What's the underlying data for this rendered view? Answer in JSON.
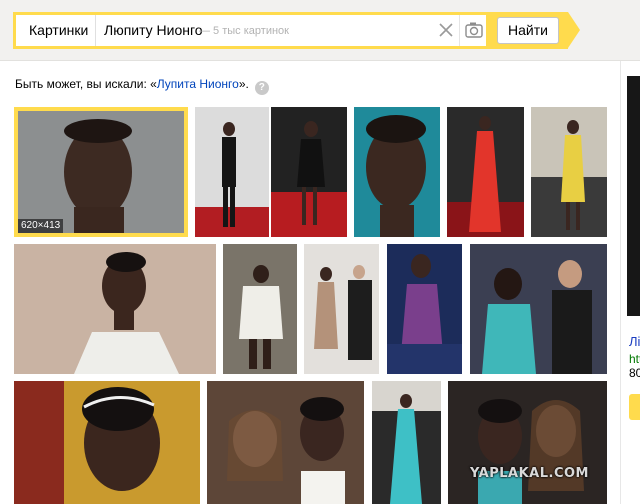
{
  "search": {
    "scope": "Картинки",
    "query": "Люпиту Нионго",
    "hint": "— 5 тыс картинок",
    "submit_label": "Найти"
  },
  "suggestion": {
    "prefix": "Быть может, вы искали: «",
    "link": "Лупита Нионго",
    "suffix": "».",
    "help": "?"
  },
  "selected_image": {
    "size_label": "620×413"
  },
  "side_panel": {
    "line1": "Лі",
    "line2": "htt",
    "line3": "80"
  },
  "watermark": "YAPLAKAL.COM",
  "colors": {
    "accent": "#ffdb4d",
    "link": "#0044bb",
    "topbar_bg": "#f2f1ef"
  },
  "icons": {
    "clear": "close-icon",
    "camera": "camera-icon",
    "help": "question-icon"
  }
}
